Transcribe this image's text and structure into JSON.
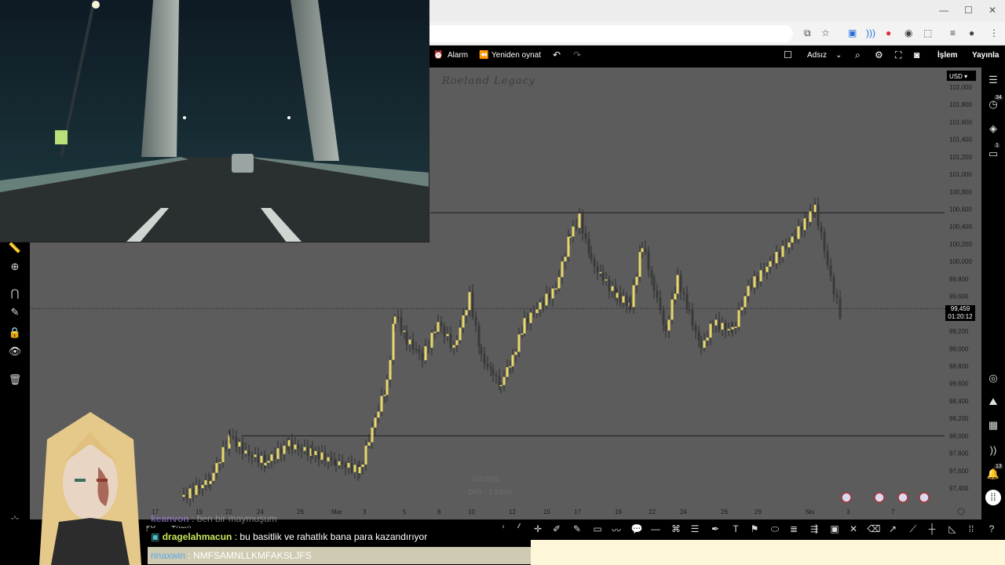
{
  "browser": {
    "window_controls": [
      "—",
      "☐",
      "✕"
    ]
  },
  "toolbar": {
    "alarm_label": "Alarm",
    "replay_label": "Yeniden oynat",
    "layout_name": "Adsız",
    "trade_label": "İşlem",
    "publish_label": "Yayınla"
  },
  "chart": {
    "watermark": "Roeland Legacy",
    "currency": "USD",
    "current_price": "99,459",
    "countdown": "01:20:12",
    "faint_date": "1/4/2026",
    "faint_symbol": "DXY · 1 240H",
    "price_levels": [
      "102,000",
      "101,800",
      "101,600",
      "101,400",
      "101,200",
      "101,000",
      "100,800",
      "100,600",
      "100,400",
      "100,200",
      "100,000",
      "99,800",
      "99,600",
      "99,400",
      "99,200",
      "99,000",
      "98,800",
      "98,600",
      "98,400",
      "98,200",
      "98,000",
      "97,800",
      "97,600",
      "97,400"
    ],
    "time_labels": [
      "15",
      "17",
      "19",
      "22",
      "24",
      "26",
      "Mar",
      "3",
      "5",
      "8",
      "10",
      "12",
      "15",
      "17",
      "19",
      "22",
      "24",
      "26",
      "29",
      "Nis",
      "3",
      "7"
    ],
    "resistance_level": "100,560",
    "support_level": "98,000",
    "dotted_level": "99,459"
  },
  "right_rail": {
    "badge_alerts": "34",
    "badge_messages": "1",
    "badge_notifications": "13"
  },
  "chat": {
    "messages": [
      {
        "user": "keanvon",
        "sep": " : ",
        "text": "ben bir maymuşum"
      },
      {
        "user": "dragelahmacun",
        "sep": " : ",
        "text": "bu basitlik ve rahatlık bana para kazandırıyor"
      },
      {
        "user": "rinaxwin",
        "sep": " : ",
        "text": "NMFSAMNLLKMFAKSLJFS"
      }
    ]
  },
  "misc": {
    "range_all": "Tümü",
    "range_5y": "5Y"
  },
  "colors": {
    "chart_bg": "#5c5c5c",
    "candle_up": "#e8d96a",
    "candle_down": "#3a3a3a",
    "level_line": "#1a1a1a"
  }
}
